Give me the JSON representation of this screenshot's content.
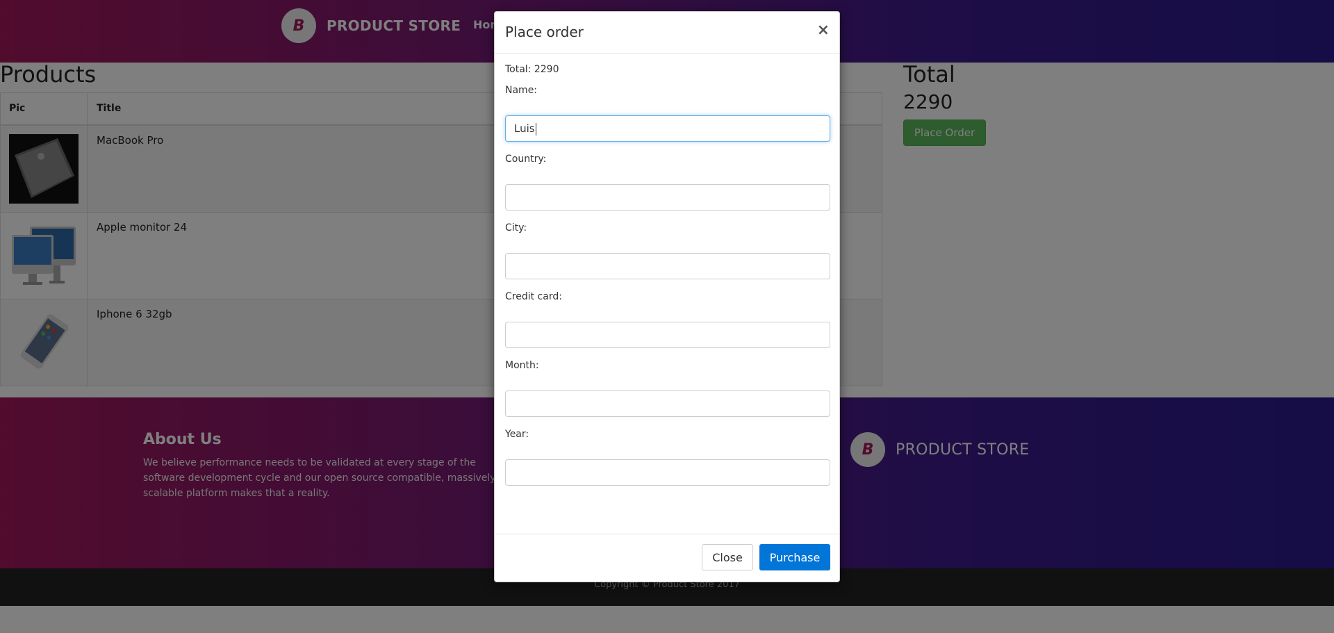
{
  "navbar": {
    "brand": "PRODUCT STORE",
    "logo_letter": "B",
    "home_link": "Hom"
  },
  "products": {
    "title": "Products",
    "columns": [
      "Pic",
      "Title"
    ],
    "rows": [
      {
        "title": "MacBook Pro",
        "pic_icon": "macbook-image"
      },
      {
        "title": "Apple monitor 24",
        "pic_icon": "monitor-image"
      },
      {
        "title": "Iphone 6 32gb",
        "pic_icon": "iphone-image"
      }
    ]
  },
  "summary": {
    "heading": "Total",
    "value": "2290",
    "place_order_label": "Place Order"
  },
  "footer": {
    "about_title": "About Us",
    "about_text": "We believe performance needs to be validated at every stage of the software development cycle and our open source compatible, massively scalable platform makes that a reality.",
    "brand": "PRODUCT STORE",
    "copyright": "Copyright © Product Store 2017"
  },
  "modal": {
    "title": "Place order",
    "close_x": "×",
    "total_text": "Total: 2290",
    "fields": {
      "name": {
        "label": "Name:",
        "value": "Luis"
      },
      "country": {
        "label": "Country:",
        "value": ""
      },
      "city": {
        "label": "City:",
        "value": ""
      },
      "card": {
        "label": "Credit card:",
        "value": ""
      },
      "month": {
        "label": "Month:",
        "value": ""
      },
      "year": {
        "label": "Year:",
        "value": ""
      }
    },
    "close_label": "Close",
    "purchase_label": "Purchase"
  },
  "colors": {
    "brand_gradient_start": "#a3195b",
    "brand_gradient_end": "#2b1a8f",
    "success": "#5cb85c",
    "primary": "#0275d8"
  }
}
